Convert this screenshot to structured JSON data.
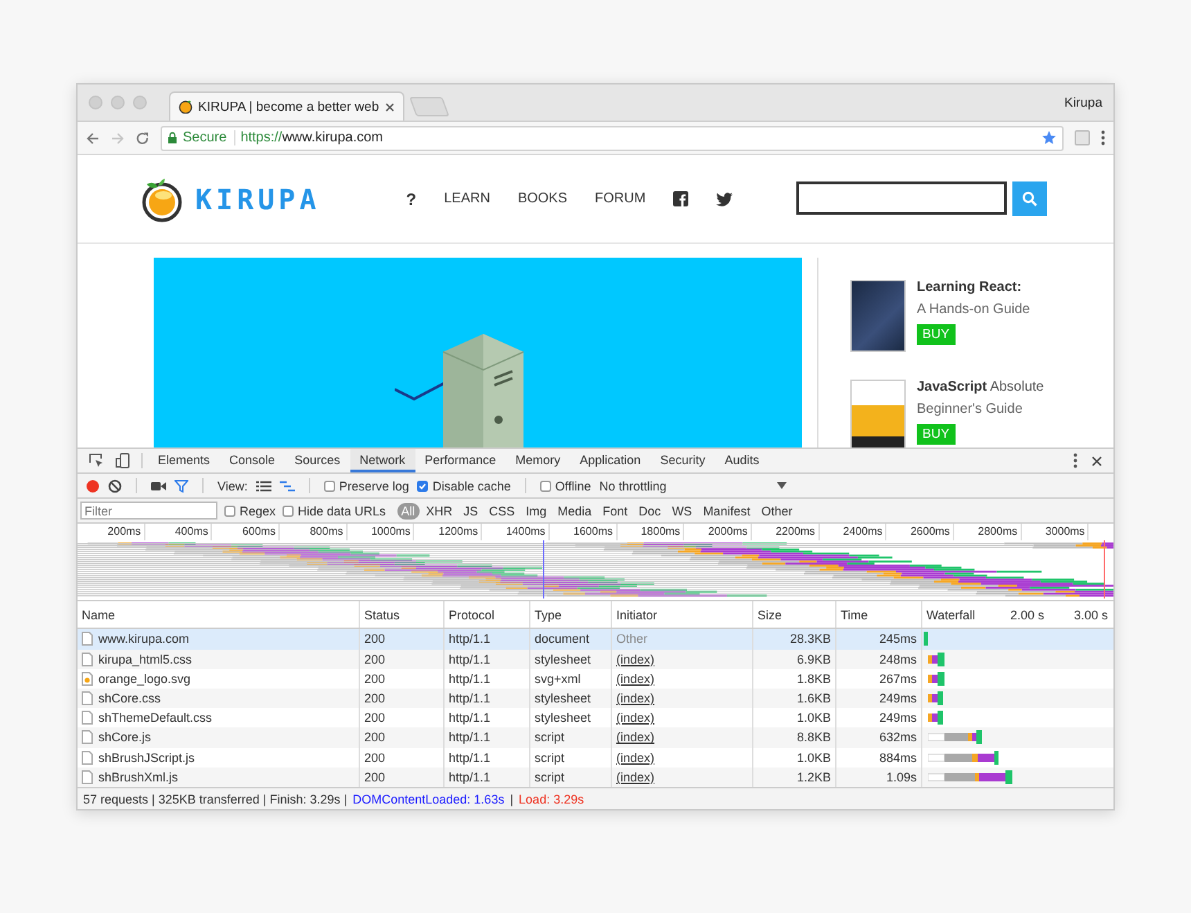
{
  "browser": {
    "tab_title": "KIRUPA | become a better web",
    "profile": "Kirupa",
    "secure_label": "Secure",
    "url_scheme": "https://",
    "url_host": "www.kirupa.com"
  },
  "site": {
    "logo_text": "KIRUPA",
    "nav": [
      "?",
      "LEARN",
      "BOOKS",
      "FORUM"
    ],
    "books": [
      {
        "title_bold": "Learning React:",
        "subtitle": "A Hands-on Guide",
        "buy": "BUY"
      },
      {
        "title_bold": "JavaScript",
        "title_rest": "Absolute",
        "subtitle": "Beginner's Guide",
        "buy": "BUY"
      }
    ]
  },
  "devtools": {
    "tabs": [
      {
        "label": "Elements",
        "selected": false
      },
      {
        "label": "Console",
        "selected": false
      },
      {
        "label": "Sources",
        "selected": false
      },
      {
        "label": "Network",
        "selected": true
      },
      {
        "label": "Performance",
        "selected": false
      },
      {
        "label": "Memory",
        "selected": false
      },
      {
        "label": "Application",
        "selected": false
      },
      {
        "label": "Security",
        "selected": false
      },
      {
        "label": "Audits",
        "selected": false
      }
    ],
    "toolbar": {
      "recording": true,
      "view_label": "View:",
      "preserve_log": {
        "label": "Preserve log",
        "checked": false
      },
      "disable_cache": {
        "label": "Disable cache",
        "checked": true
      },
      "offline": {
        "label": "Offline",
        "checked": false
      },
      "throttling": "No throttling"
    },
    "filter": {
      "placeholder": "Filter",
      "regex": {
        "label": "Regex",
        "checked": false
      },
      "hide_data_urls": {
        "label": "Hide data URLs",
        "checked": false
      },
      "types": [
        {
          "label": "All",
          "selected": true
        },
        {
          "label": "XHR",
          "selected": false
        },
        {
          "label": "JS",
          "selected": false
        },
        {
          "label": "CSS",
          "selected": false
        },
        {
          "label": "Img",
          "selected": false
        },
        {
          "label": "Media",
          "selected": false
        },
        {
          "label": "Font",
          "selected": false
        },
        {
          "label": "Doc",
          "selected": false
        },
        {
          "label": "WS",
          "selected": false
        },
        {
          "label": "Manifest",
          "selected": false
        },
        {
          "label": "Other",
          "selected": false
        }
      ]
    },
    "overview": {
      "ticks": [
        "200ms",
        "400ms",
        "600ms",
        "800ms",
        "1000ms",
        "1200ms",
        "1400ms",
        "1600ms",
        "1800ms",
        "2000ms",
        "2200ms",
        "2400ms",
        "2600ms",
        "2800ms",
        "3000ms"
      ]
    },
    "table": {
      "columns": [
        "Name",
        "Status",
        "Protocol",
        "Type",
        "Initiator",
        "Size",
        "Time",
        "Waterfall"
      ],
      "waterfall_ticks": [
        "2.00 s",
        "3.00 s"
      ],
      "rows": [
        {
          "kind": "document",
          "name": "www.kirupa.com",
          "status": "200",
          "protocol": "http/1.1",
          "type": "document",
          "initiator": "Other",
          "initiator_link": false,
          "size": "28.3KB",
          "time": "245ms",
          "selected": true
        },
        {
          "kind": "document",
          "name": "kirupa_html5.css",
          "status": "200",
          "protocol": "http/1.1",
          "type": "stylesheet",
          "initiator": "(index)",
          "initiator_link": true,
          "size": "6.9KB",
          "time": "248ms",
          "selected": false
        },
        {
          "kind": "image",
          "name": "orange_logo.svg",
          "status": "200",
          "protocol": "http/1.1",
          "type": "svg+xml",
          "initiator": "(index)",
          "initiator_link": true,
          "size": "1.8KB",
          "time": "267ms",
          "selected": false
        },
        {
          "kind": "document",
          "name": "shCore.css",
          "status": "200",
          "protocol": "http/1.1",
          "type": "stylesheet",
          "initiator": "(index)",
          "initiator_link": true,
          "size": "1.6KB",
          "time": "249ms",
          "selected": false
        },
        {
          "kind": "document",
          "name": "shThemeDefault.css",
          "status": "200",
          "protocol": "http/1.1",
          "type": "stylesheet",
          "initiator": "(index)",
          "initiator_link": true,
          "size": "1.0KB",
          "time": "249ms",
          "selected": false
        },
        {
          "kind": "document",
          "name": "shCore.js",
          "status": "200",
          "protocol": "http/1.1",
          "type": "script",
          "initiator": "(index)",
          "initiator_link": true,
          "size": "8.8KB",
          "time": "632ms",
          "selected": false
        },
        {
          "kind": "document",
          "name": "shBrushJScript.js",
          "status": "200",
          "protocol": "http/1.1",
          "type": "script",
          "initiator": "(index)",
          "initiator_link": true,
          "size": "1.0KB",
          "time": "884ms",
          "selected": false
        },
        {
          "kind": "document",
          "name": "shBrushXml.js",
          "status": "200",
          "protocol": "http/1.1",
          "type": "script",
          "initiator": "(index)",
          "initiator_link": true,
          "size": "1.2KB",
          "time": "1.09s",
          "selected": false
        }
      ]
    },
    "status_bar": {
      "summary": "57 requests | 325KB transferred | Finish: 3.29s |",
      "dom_content_loaded": "DOMContentLoaded: 1.63s",
      "separator": "|",
      "load": "Load: 3.29s"
    }
  }
}
